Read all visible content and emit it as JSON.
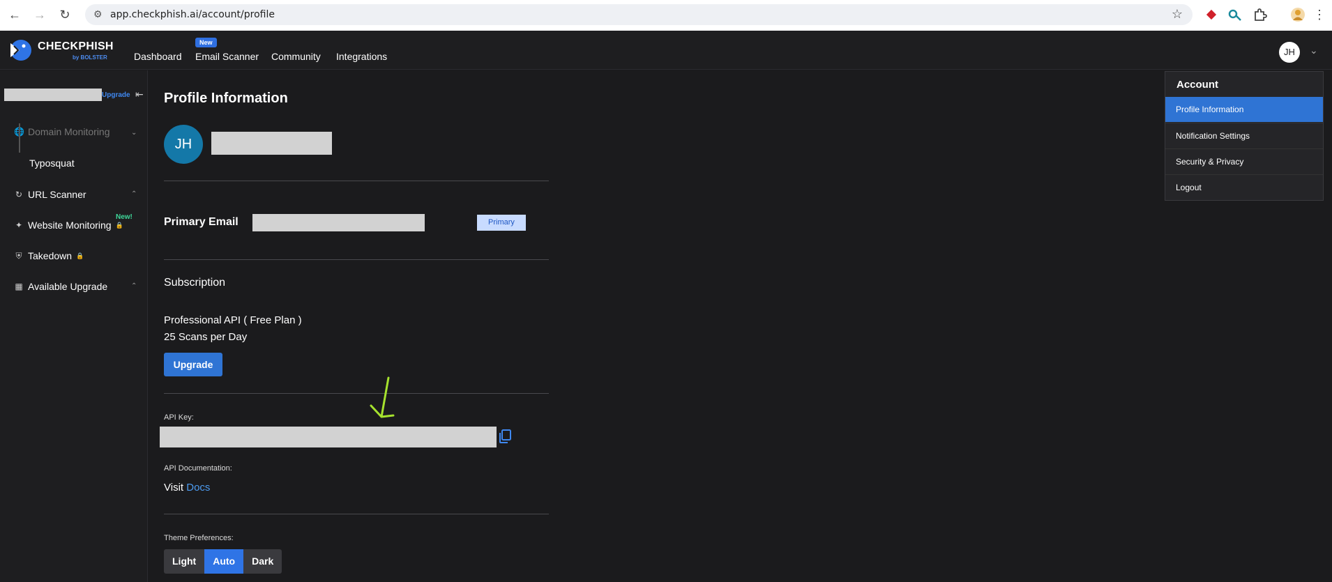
{
  "browser": {
    "url": "app.checkphish.ai/account/profile",
    "back_icon": "arrow-left-icon",
    "forward_icon": "arrow-right-icon",
    "reload_icon": "reload-icon",
    "bookmark_icon": "star-icon"
  },
  "header": {
    "brand": "CHECKPHISH",
    "brand_sub": "by BOLSTER",
    "nav": [
      "Dashboard",
      "Email Scanner",
      "Community",
      "Integrations"
    ],
    "new_badge": "New",
    "avatar_initials": "JH"
  },
  "sidebar": {
    "upgrade_link": "Upgrade",
    "items": [
      {
        "label": "Domain Monitoring",
        "icon": "globe-icon",
        "disabled": true
      },
      {
        "label": "Typosquat",
        "icon": ""
      },
      {
        "label": "URL Scanner",
        "icon": "refresh-circle-icon"
      },
      {
        "label": "Website Monitoring",
        "icon": "sparkle-icon",
        "badge": "New!",
        "locked": true
      },
      {
        "label": "Takedown",
        "icon": "shield-icon",
        "locked": true
      },
      {
        "label": "Available Upgrade",
        "icon": "grid-icon"
      }
    ]
  },
  "profile": {
    "title": "Profile Information",
    "avatar_initials": "JH",
    "primary_email_label": "Primary Email",
    "primary_badge": "Primary",
    "subscription_title": "Subscription",
    "plan_name": "Professional API ( Free Plan )",
    "plan_limit": "25 Scans per Day",
    "upgrade_button": "Upgrade",
    "api_key_label": "API Key:",
    "api_doc_label": "API Documentation:",
    "visit_text": "Visit",
    "docs_link": "Docs",
    "theme_label": "Theme Preferences:",
    "theme_options": [
      "Light",
      "Auto",
      "Dark"
    ],
    "theme_selected": "Auto"
  },
  "account_menu": {
    "heading": "Account",
    "items": [
      "Profile Information",
      "Notification Settings",
      "Security & Privacy",
      "Logout"
    ],
    "active": "Profile Information"
  },
  "colors": {
    "accent": "#2f74d4",
    "background": "#1b1b1d",
    "annotation_arrow": "#a6e22e"
  }
}
